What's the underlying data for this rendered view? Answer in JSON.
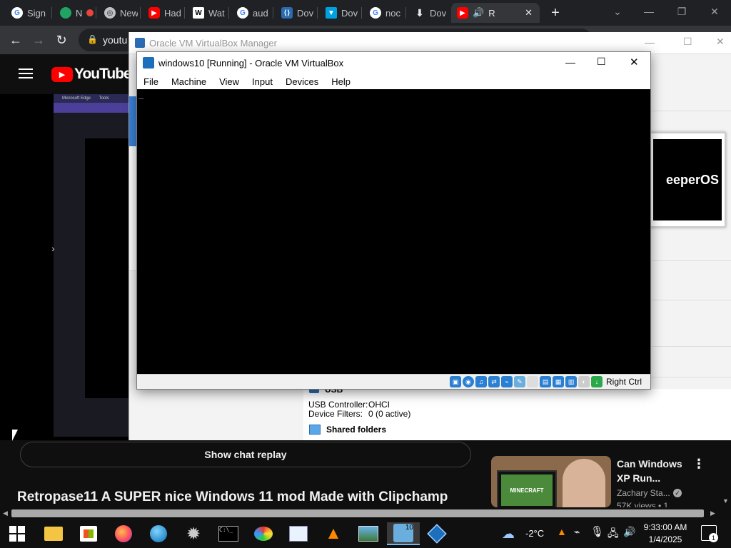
{
  "browser": {
    "tabs": [
      {
        "label": "Sign",
        "icon": "google-icon"
      },
      {
        "label": "N",
        "icon": "drive-icon"
      },
      {
        "label": "New",
        "icon": "chrome-icon"
      },
      {
        "label": "Had",
        "icon": "youtube-icon"
      },
      {
        "label": "Wat",
        "icon": "wikipedia-icon"
      },
      {
        "label": "aud",
        "icon": "google-icon"
      },
      {
        "label": "Dov",
        "icon": "vscode-icon"
      },
      {
        "label": "Dov",
        "icon": "download-arrow-icon"
      },
      {
        "label": "noc",
        "icon": "google-icon"
      },
      {
        "label": "Dov",
        "icon": "download-icon"
      },
      {
        "label": "R",
        "icon": "youtube-icon"
      }
    ],
    "new_tab": "+",
    "url": "youtu",
    "accent": "#35363a"
  },
  "youtube": {
    "logo_text": "YouTube",
    "chat_replay": "Show chat replay",
    "video_title": "Retropase11 A SUPER nice Windows 11 mod Made with Clipchamp",
    "related": {
      "title_line1": "Can Windows",
      "title_line2": "XP Run...",
      "channel": "Zachary Sta...",
      "views": "57K views • 1",
      "thumb_text": "MINECRAFT"
    },
    "thumb_header": "Microsoft Edge",
    "thumb_tab": "Tools"
  },
  "vbox_manager": {
    "title": "Oracle VM VirtualBox Manager",
    "preview_text": "eeperOS",
    "usb_label_partial": "USB",
    "usb_controller_label": "USB Controller:",
    "usb_controller_value": "OHCI",
    "device_filters_label": "Device Filters:",
    "device_filters_value": "0 (0 active)",
    "shared_folders": "Shared folders"
  },
  "vm_window": {
    "title": "windows10 [Running] - Oracle VM VirtualBox",
    "menu": [
      "File",
      "Machine",
      "View",
      "Input",
      "Devices",
      "Help"
    ],
    "cursor": "_",
    "host_key": "Right Ctrl"
  },
  "taskbar": {
    "apps": [
      "windows-start-icon",
      "file-explorer-icon",
      "microsoft-store-icon",
      "firefox-icon",
      "earth-icon",
      "settings-gear-icon",
      "command-prompt-icon",
      "paint-icon",
      "notepad-icon",
      "vlc-icon",
      "photos-icon",
      "virtualbox-win10-icon",
      "virtualbox-icon"
    ],
    "temperature": "-2°C",
    "time": "9:33:00 AM",
    "date": "1/4/2025",
    "notification_count": "1"
  }
}
